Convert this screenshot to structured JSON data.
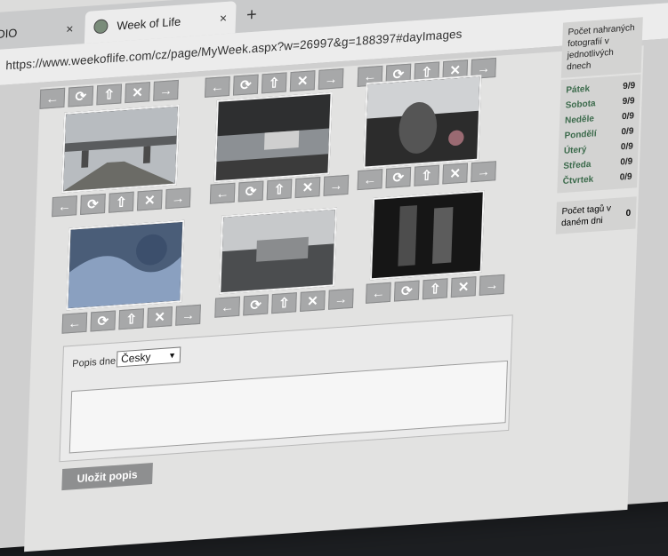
{
  "browser": {
    "inactive_tab_label": "ADIO",
    "active_tab_label": "Week of Life",
    "new_tab_symbol": "+",
    "close_symbol": "×",
    "url": "https://www.weekoflife.com/cz/page/MyWeek.aspx?w=26997&g=188397#dayImages"
  },
  "gallery": {
    "button_icons": [
      "arrow-left-icon",
      "rotate-icon",
      "upload-icon",
      "delete-icon",
      "arrow-right-icon"
    ],
    "button_glyphs": [
      "←",
      "⟳",
      "⇧",
      "✕",
      "→"
    ]
  },
  "sidebar": {
    "uploaded_header": "Počet nahraných fotografií v jednotlivých dnech",
    "days": [
      {
        "name": "Pátek",
        "count": "9/9"
      },
      {
        "name": "Sobota",
        "count": "9/9"
      },
      {
        "name": "Neděle",
        "count": "0/9"
      },
      {
        "name": "Pondělí",
        "count": "0/9"
      },
      {
        "name": "Úterý",
        "count": "0/9"
      },
      {
        "name": "Středa",
        "count": "0/9"
      },
      {
        "name": "Čtvrtek",
        "count": "0/9"
      }
    ],
    "tags_label": "Počet tagů v daném dni",
    "tags_value": "0"
  },
  "description": {
    "label": "Popis dne:",
    "language_value": "Česky",
    "textarea_value": "",
    "save_label": "Uložit popis"
  }
}
